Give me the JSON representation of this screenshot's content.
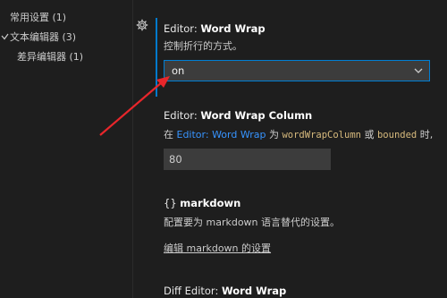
{
  "toc": {
    "items": [
      {
        "label": "常用设置",
        "count": "(1)"
      },
      {
        "label": "文本编辑器",
        "count": "(3)"
      },
      {
        "label": "差异编辑器",
        "count": "(1)"
      }
    ]
  },
  "settings": {
    "word_wrap": {
      "category": "Editor: ",
      "name": "Word Wrap",
      "description": "控制折行的方式。",
      "value": "on"
    },
    "word_wrap_column": {
      "category": "Editor: ",
      "name": "Word Wrap Column",
      "desc_prefix": "在 ",
      "desc_link": "Editor: Word Wrap",
      "desc_mid": " 为 ",
      "desc_code1": "wordWrapColumn",
      "desc_or": " 或 ",
      "desc_code2": "bounded",
      "desc_suffix": " 时,",
      "value": "80"
    },
    "markdown": {
      "braces": "{}",
      "name": "markdown",
      "description": "配置要为 markdown 语言替代的设置。",
      "edit_link": "编辑 markdown 的设置"
    },
    "diff_word_wrap": {
      "category": "Diff Editor: ",
      "name": "Word Wrap"
    }
  },
  "colors": {
    "background": "#1e1e1e",
    "accent": "#007acc",
    "link": "#3794ff",
    "arrow": "#e8262b"
  },
  "icons": {
    "gear": "gear-icon",
    "dropdown": "chevron-down-icon",
    "toc_expand": "chevron-expanded-icon"
  }
}
